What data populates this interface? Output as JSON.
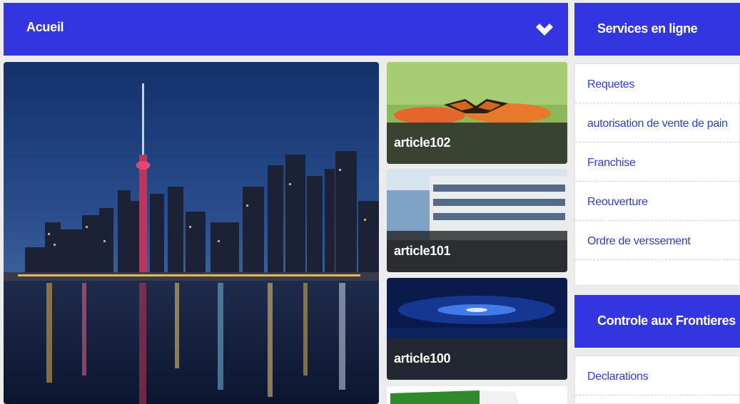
{
  "main": {
    "header_title": "Acueil"
  },
  "articles": [
    {
      "caption": "article102"
    },
    {
      "caption": "article101"
    },
    {
      "caption": "article100"
    }
  ],
  "services": {
    "title": "Services en ligne",
    "items": [
      "Requetes",
      "autorisation de vente de pain",
      "Franchise",
      "Reouverture",
      "Ordre de verssement"
    ]
  },
  "frontieres": {
    "title": "Controle aux Frontieres",
    "items": [
      "Declarations"
    ]
  },
  "colors": {
    "accent": "#3336e0",
    "link": "#2a3fd8",
    "background": "#ececec"
  }
}
